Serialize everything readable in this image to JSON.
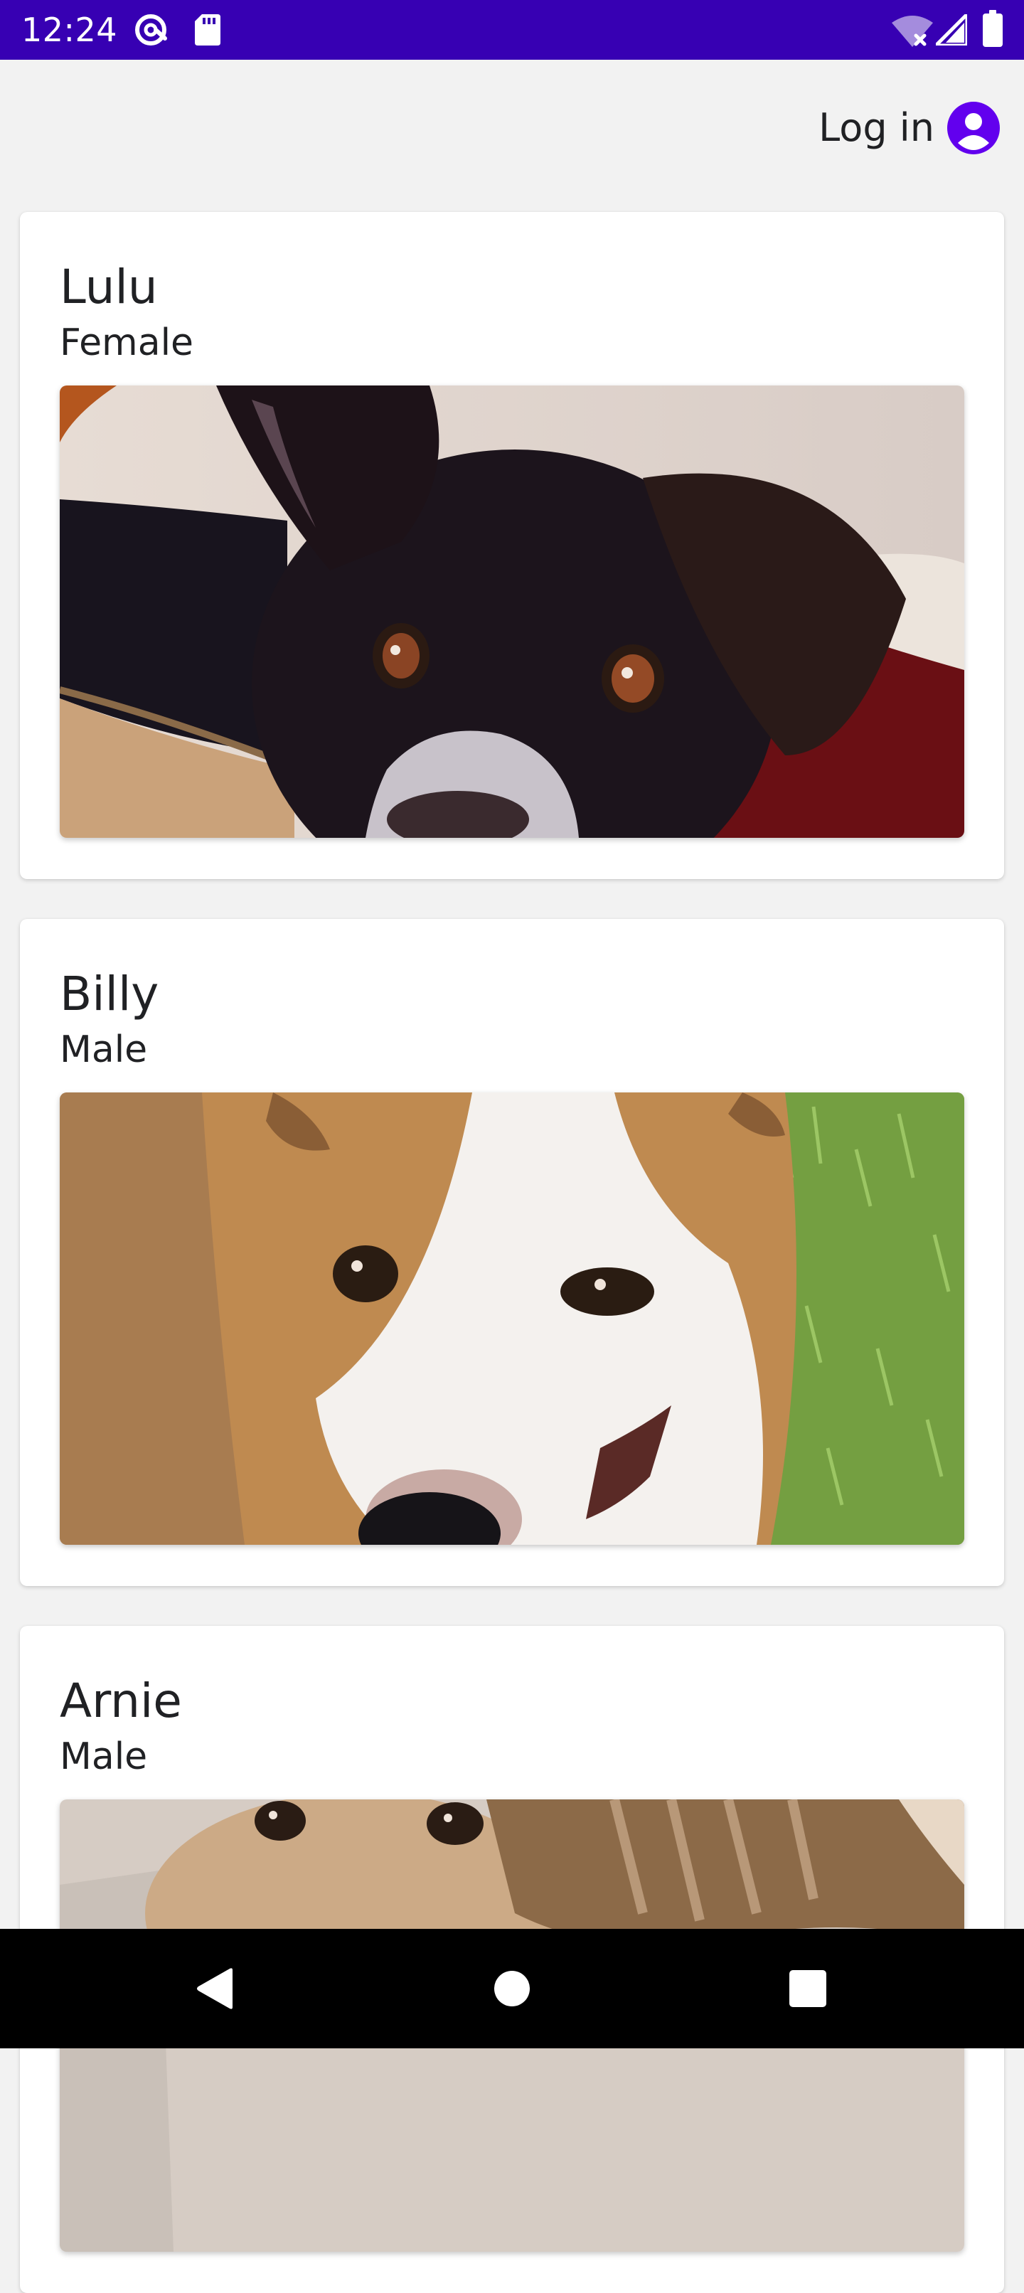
{
  "status_bar": {
    "time": "12:24",
    "background": "#3700b3",
    "left_icons": [
      "at-sign-icon",
      "sd-card-icon"
    ],
    "right_icons": [
      "wifi-off-icon",
      "cell-signal-icon",
      "battery-icon"
    ]
  },
  "header": {
    "login_label": "Log in",
    "login_icon": "account-circle-icon",
    "accent": "#6200ee"
  },
  "pets": [
    {
      "name": "Lulu",
      "sex": "Female",
      "photo": "black-dog-photo"
    },
    {
      "name": "Billy",
      "sex": "Male",
      "photo": "tan-white-dog-photo"
    },
    {
      "name": "Arnie",
      "sex": "Male",
      "photo": "light-tan-dog-photo"
    }
  ],
  "nav_bar": {
    "buttons": [
      "back-icon",
      "home-icon",
      "recents-icon"
    ]
  }
}
